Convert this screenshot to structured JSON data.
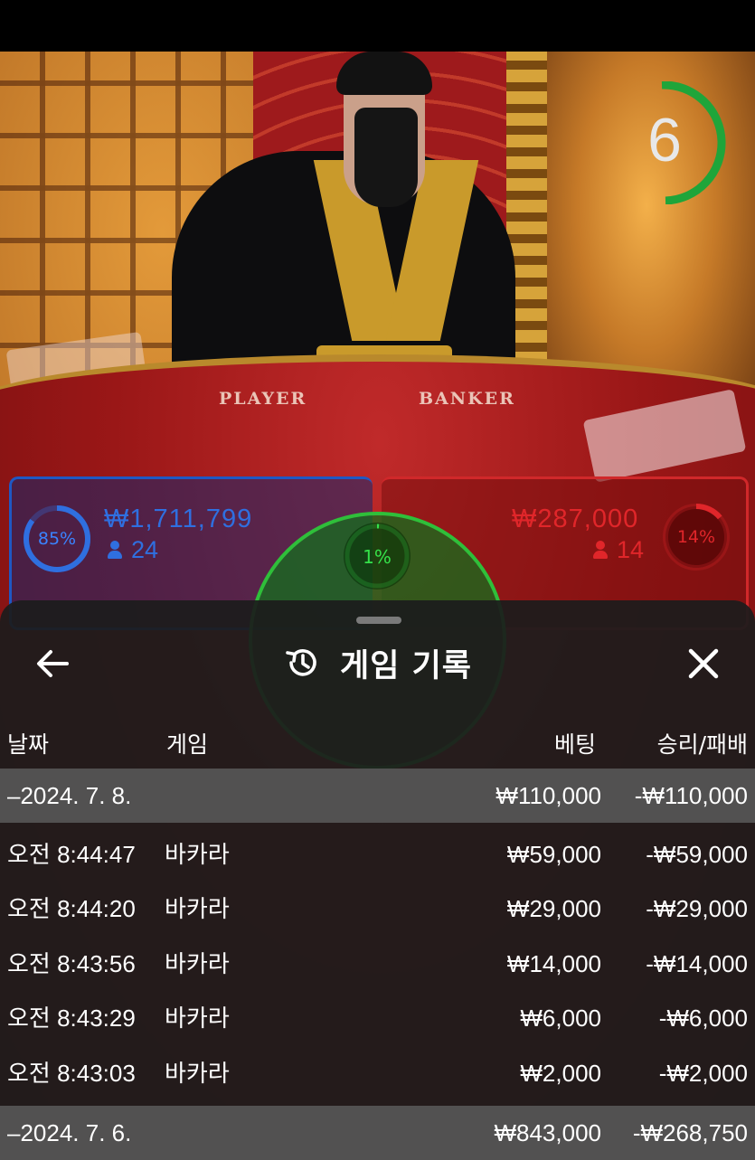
{
  "live": {
    "countdown": "6",
    "table_labels": {
      "player": "PLAYER",
      "banker": "BANKER"
    },
    "player": {
      "percent": "85%",
      "stake": "₩1,711,799",
      "players": "24",
      "color": "#2f6fe0"
    },
    "banker": {
      "percent": "14%",
      "stake": "₩287,000",
      "players": "14",
      "color": "#e0262a"
    },
    "tie": {
      "percent": "1%",
      "color": "#35e24a"
    }
  },
  "sheet": {
    "title": "게임 기록",
    "columns": {
      "date": "날짜",
      "game": "게임",
      "bet": "베팅",
      "result": "승리/패배"
    },
    "rows": [
      {
        "kind": "date",
        "date": "–2024. 7. 8.",
        "bet": "₩110,000",
        "result": "-₩110,000"
      },
      {
        "kind": "game",
        "time": "오전 8:44:47",
        "game": "바카라",
        "bet": "₩59,000",
        "result": "-₩59,000"
      },
      {
        "kind": "game",
        "time": "오전 8:44:20",
        "game": "바카라",
        "bet": "₩29,000",
        "result": "-₩29,000"
      },
      {
        "kind": "game",
        "time": "오전 8:43:56",
        "game": "바카라",
        "bet": "₩14,000",
        "result": "-₩14,000"
      },
      {
        "kind": "game",
        "time": "오전 8:43:29",
        "game": "바카라",
        "bet": "₩6,000",
        "result": "-₩6,000"
      },
      {
        "kind": "game",
        "time": "오전 8:43:03",
        "game": "바카라",
        "bet": "₩2,000",
        "result": "-₩2,000"
      },
      {
        "kind": "date",
        "date": "–2024. 7. 6.",
        "bet": "₩843,000",
        "result": "-₩268,750"
      }
    ]
  },
  "icons": {
    "back": "arrow-left-icon",
    "history": "history-icon",
    "close": "close-icon"
  }
}
